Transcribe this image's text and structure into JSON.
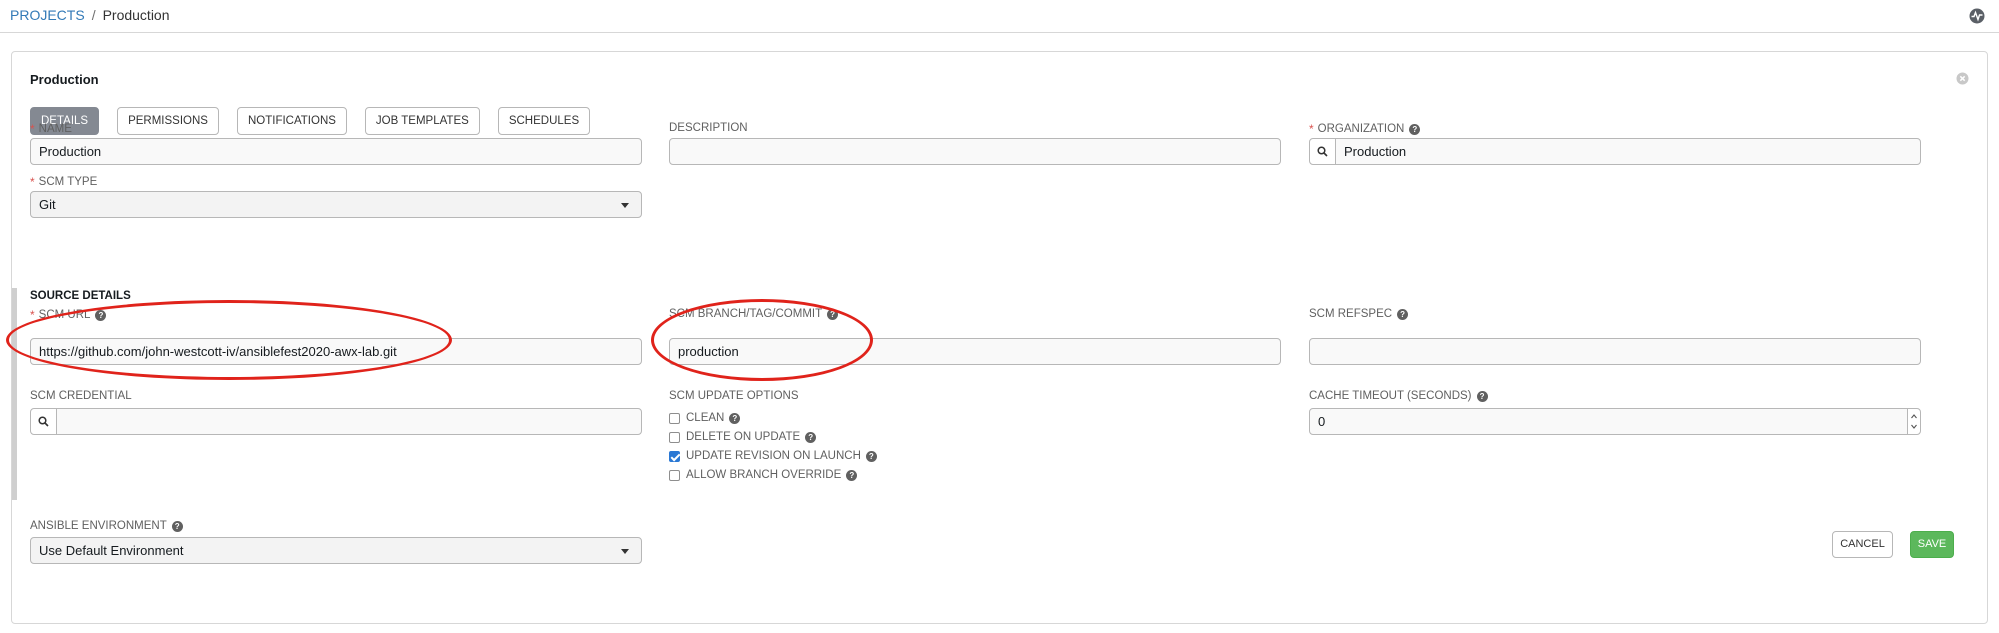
{
  "breadcrumb": {
    "root": "PROJECTS",
    "separator": "/",
    "current": "Production"
  },
  "header": {
    "activity_icon": "activity-stream-icon"
  },
  "panel": {
    "title": "Production",
    "close_icon": "close-circle-icon",
    "tabs": [
      {
        "label": "DETAILS",
        "active": true
      },
      {
        "label": "PERMISSIONS",
        "active": false
      },
      {
        "label": "NOTIFICATIONS",
        "active": false
      },
      {
        "label": "JOB TEMPLATES",
        "active": false
      },
      {
        "label": "SCHEDULES",
        "active": false
      }
    ]
  },
  "form": {
    "required_mark": "*",
    "help_glyph": "?",
    "name": {
      "label": "NAME",
      "value": "Production"
    },
    "description": {
      "label": "DESCRIPTION",
      "value": ""
    },
    "organization": {
      "label": "ORGANIZATION",
      "value": "Production"
    },
    "scm_type": {
      "label": "SCM TYPE",
      "value": "Git"
    },
    "source_details": {
      "title": "SOURCE DETAILS"
    },
    "scm_url": {
      "label": "SCM URL",
      "value": "https://github.com/john-westcott-iv/ansiblefest2020-awx-lab.git"
    },
    "scm_branch": {
      "label": "SCM BRANCH/TAG/COMMIT",
      "value": "production"
    },
    "scm_refspec": {
      "label": "SCM REFSPEC",
      "value": ""
    },
    "scm_credential": {
      "label": "SCM CREDENTIAL",
      "value": ""
    },
    "scm_update_options": {
      "label": "SCM UPDATE OPTIONS",
      "options": [
        {
          "label": "CLEAN",
          "checked": false
        },
        {
          "label": "DELETE ON UPDATE",
          "checked": false
        },
        {
          "label": "UPDATE REVISION ON LAUNCH",
          "checked": true
        },
        {
          "label": "ALLOW BRANCH OVERRIDE",
          "checked": false
        }
      ]
    },
    "cache_timeout": {
      "label": "CACHE TIMEOUT (SECONDS)",
      "value": "0"
    },
    "ansible_environment": {
      "label": "ANSIBLE ENVIRONMENT",
      "value": "Use Default Environment"
    }
  },
  "actions": {
    "cancel_label": "CANCEL",
    "save_label": "SAVE"
  },
  "colors": {
    "accent_save": "#5cb85c",
    "link": "#337ab7",
    "required": "#d9534f",
    "annotation": "#e0231b",
    "active_tab": "#848992"
  }
}
